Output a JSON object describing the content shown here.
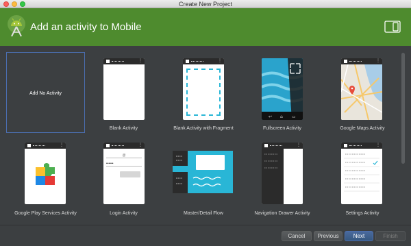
{
  "window": {
    "title": "Create New Project"
  },
  "header": {
    "title": "Add an activity to Mobile"
  },
  "activities": [
    {
      "label": "Add No Activity"
    },
    {
      "label": "Blank Activity"
    },
    {
      "label": "Blank Activity with Fragment"
    },
    {
      "label": "Fullscreen Activity"
    },
    {
      "label": "Google Maps Activity"
    },
    {
      "label": "Google Play Services Activity"
    },
    {
      "label": "Login Activity"
    },
    {
      "label": "Master/Detail Flow"
    },
    {
      "label": "Navigation Drawer Activity"
    },
    {
      "label": "Settings Activity"
    }
  ],
  "login_preview": {
    "email": "@",
    "password": "••••••"
  },
  "buttons": {
    "cancel": "Cancel",
    "previous": "Previous",
    "next": "Next",
    "finish": "Finish"
  },
  "colors": {
    "header": "#4e8b2e",
    "background": "#3c3f41",
    "selection": "#4b6eaf",
    "accent": "#29b6d6"
  }
}
